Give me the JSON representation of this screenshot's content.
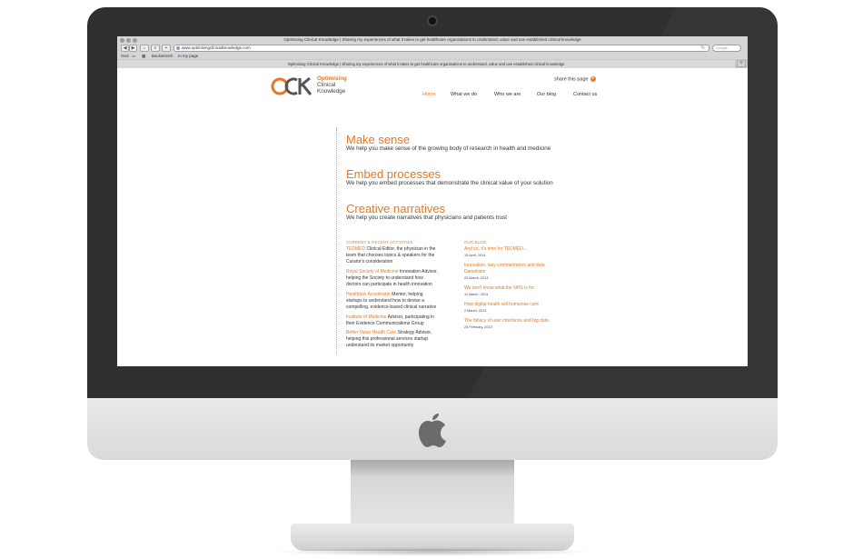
{
  "browser": {
    "window_title": "Optimising Clinical Knowledge | Sharing my experiences of what it takes to get healthcare organisations to understand, value and use established clinical knowledge",
    "url": "www.optimisingclinicalknowledge.com",
    "search_placeholder": "Google",
    "bookmarks": [
      "Ged",
      "Backstretch",
      "to my page"
    ],
    "tab_title": "Optimising Clinical Knowledge | Sharing my experiences of what it takes to get healthcare organisations to understand, value and use established clinical knowledge",
    "new_tab": "+"
  },
  "site": {
    "logo_mark": "OCK",
    "logo_lines": [
      "Optimising",
      "Clinical",
      "Knowledge"
    ],
    "share_label": "share this page",
    "share_icon": "plus-icon",
    "nav": [
      "Home",
      "What we do",
      "Who we are",
      "Our blog",
      "Contact us"
    ],
    "accent_color": "#e87722",
    "hero": [
      {
        "title": "Make sense",
        "text": "We help you make sense of the growing body of research in health and medicine"
      },
      {
        "title": "Embed processes",
        "text": "We help you embed processes that demonstrate the clinical value of your solution"
      },
      {
        "title": "Creative narratives",
        "text": "We help you create narratives that physicians and patients trust"
      }
    ],
    "activities_heading": "CURRENT & RECENT ACTIVITIES",
    "activities": [
      {
        "org": "TEDMED",
        "l1": " Clinical Editor, the physician in the",
        "l2": "team that chooses topics & speakers for the",
        "l3": "Curator's consideration"
      },
      {
        "org": "Royal Society of Medicine",
        "l1": " Innovation Advisor,",
        "l2": "helping the Society to understand how",
        "l3": "doctors can participate in health innovation"
      },
      {
        "org": "Healthbox Accelerator",
        "l1": " Mentor, helping",
        "l2": "startups to understand how to devise a",
        "l3": "compelling, evidence-based clinical narrative"
      },
      {
        "org": "Institute of Medicine",
        "l1": " Advisor, participating in",
        "l2": "their Evidence Communications Group",
        "l3": ""
      },
      {
        "org": "Better Value Health Care",
        "l1": " Strategy Advisor,",
        "l2": "helping this professional services startup",
        "l3": "understand its market opportunity"
      }
    ],
    "blog_heading": "OUR BLOG",
    "blog": [
      {
        "title": "And so, it's time for TEDMED...",
        "title2": "",
        "date": "15 April, 2013"
      },
      {
        "title": "Innovation, lazy commentators and data",
        "title2": "Darwinism",
        "date": "22 March, 2013"
      },
      {
        "title": "We don't know what the NHS is for",
        "title2": "",
        "date": "11 March, 2013"
      },
      {
        "title": "How digital health will humanise care",
        "title2": "",
        "date": "2 March, 2013"
      },
      {
        "title": "The fallacy of user interfaces and big data",
        "title2": "",
        "date": "25 February, 2013"
      }
    ]
  },
  "device": {
    "logo_icon": "apple-logo-icon"
  }
}
